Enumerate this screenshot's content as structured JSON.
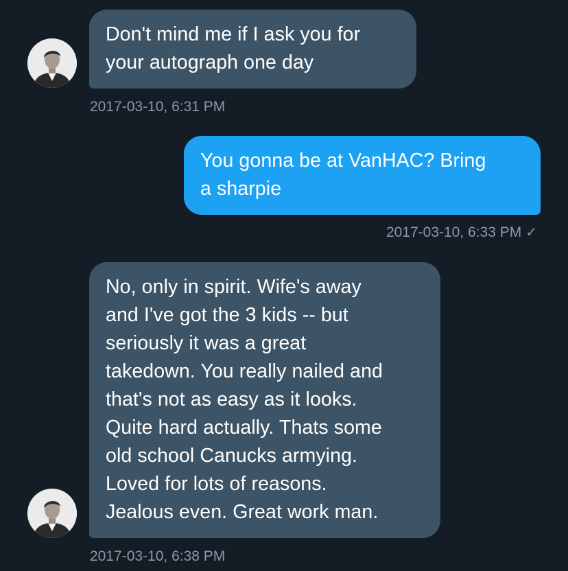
{
  "conversation": {
    "messages": [
      {
        "direction": "incoming",
        "text": "Don't mind me if I ask you for\nyour autograph one day",
        "timestamp": "2017-03-10, 6:31 PM"
      },
      {
        "direction": "outgoing",
        "text": "You gonna be at VanHAC? Bring\na sharpie",
        "timestamp": "2017-03-10, 6:33 PM",
        "status_icon": "✓"
      },
      {
        "direction": "incoming",
        "text": "No, only in spirit. Wife's away\nand I've got the 3 kids -- but\nseriously it was a great\ntakedown. You really nailed and\nthat's not as easy as it looks.\nQuite hard actually. Thats some\nold school Canucks armying.\nLoved for lots of reasons.\nJealous even. Great work man.",
        "timestamp": "2017-03-10, 6:38 PM"
      }
    ]
  },
  "colors": {
    "background": "#141d26",
    "incoming_bubble": "#3d5466",
    "outgoing_bubble": "#1da1f2",
    "timestamp_text": "#8899a6"
  }
}
